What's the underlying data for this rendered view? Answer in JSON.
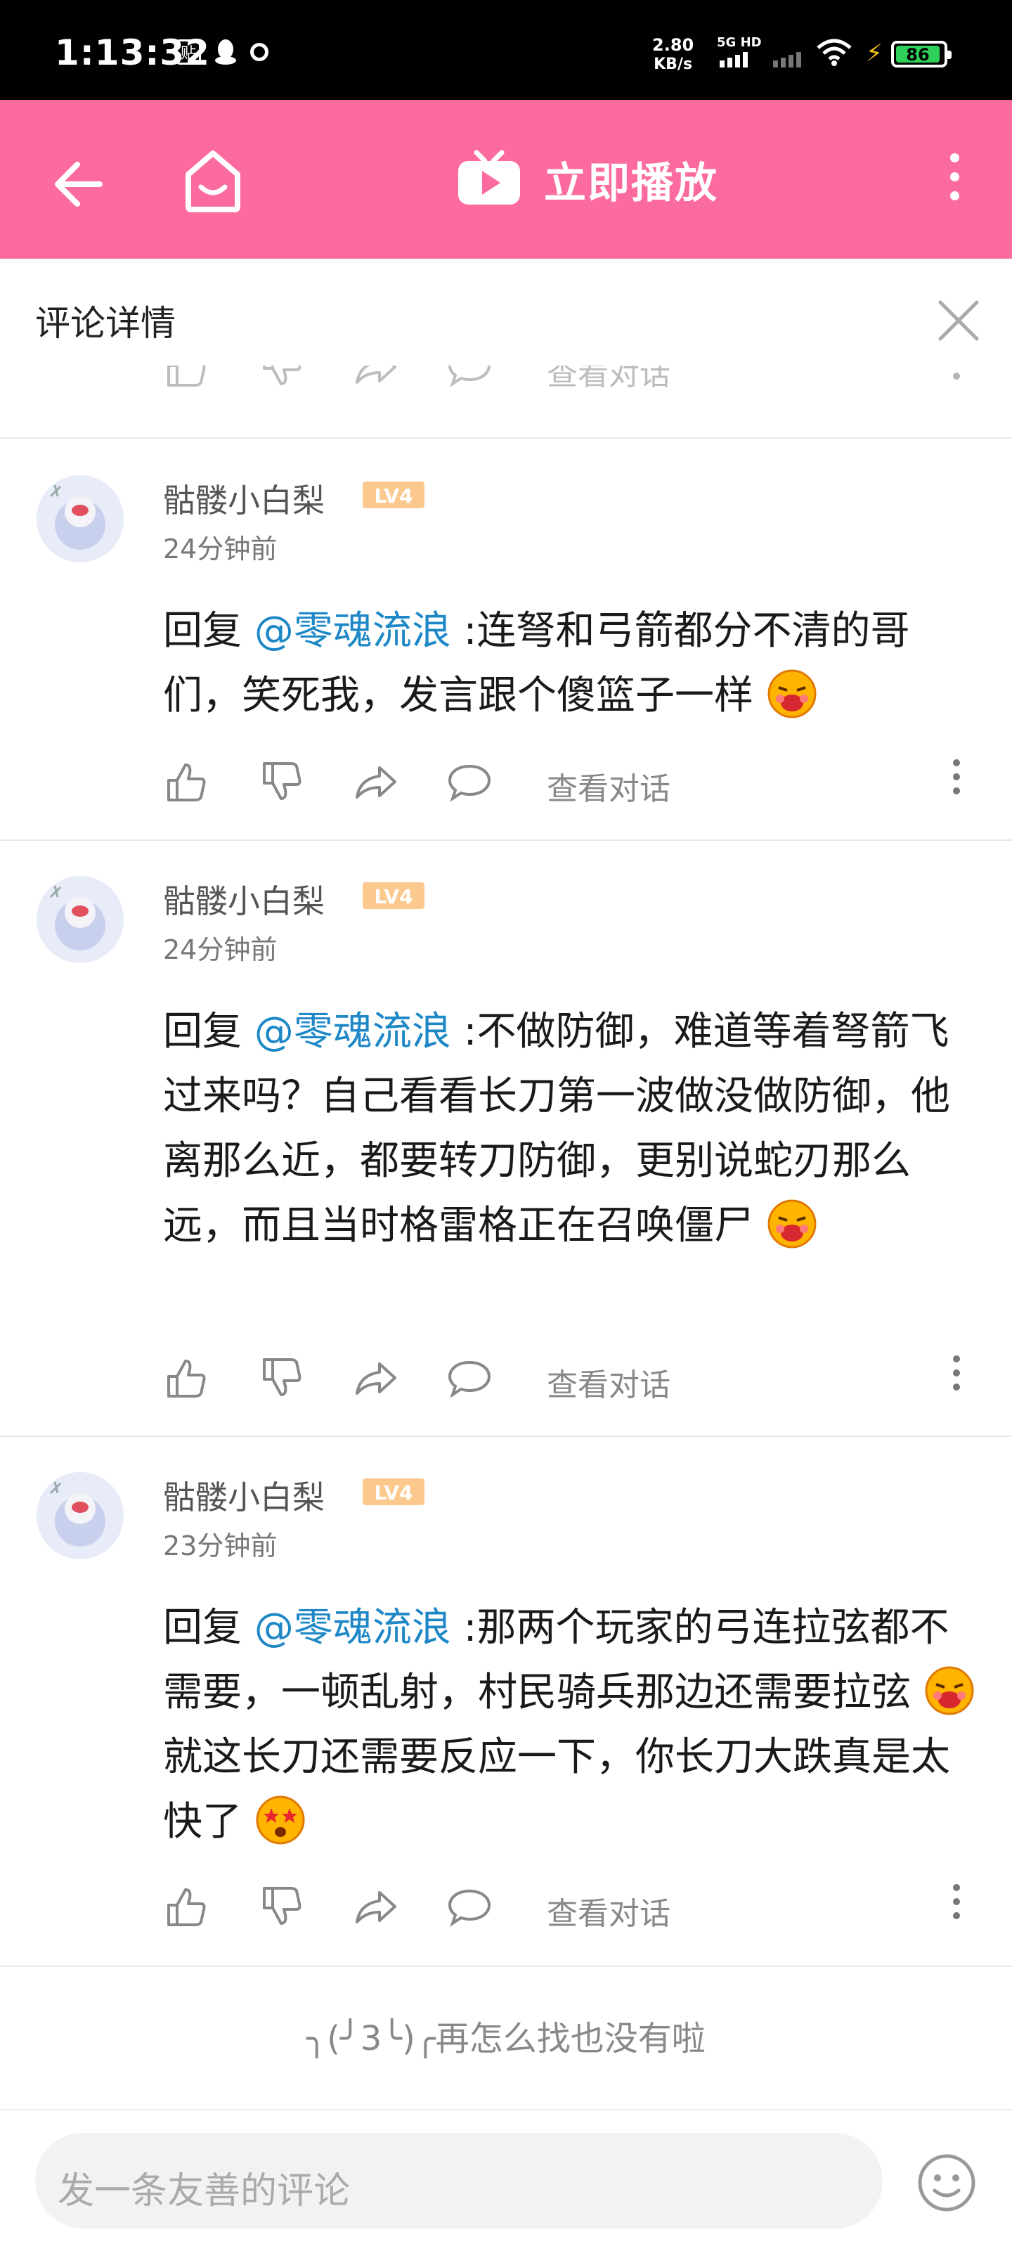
{
  "status_bar": {
    "time": "1:13:32",
    "net_speed_top": "2.80",
    "net_speed_unit": "KB/s",
    "signal_label": "5G HD",
    "battery": "86",
    "notif_icon_1": "贴"
  },
  "top_bar": {
    "title": "立即播放",
    "back_icon": "back-arrow-icon",
    "home_icon": "home-icon",
    "tv_icon": "tv-play-icon",
    "more_icon": "more-vertical-icon",
    "bg_color": "#fb6ba0"
  },
  "panel": {
    "title": "评论详情",
    "close_icon": "close-icon"
  },
  "comments": [
    {
      "user": "骷髅小白梨",
      "level": "LV4",
      "time": "24分钟前",
      "reply_prefix": "回复 ",
      "mention": "@零魂流浪",
      "text": " :连弩和弓箭都分不清的哥们，笑死我，发言跟个傻篮子一样",
      "action_label": "查看对话"
    },
    {
      "user": "骷髅小白梨",
      "level": "LV4",
      "time": "24分钟前",
      "reply_prefix": "回复 ",
      "mention": "@零魂流浪",
      "text": " :不做防御，难道等着弩箭飞过来吗？自己看看长刀第一波做没做防御，他离那么近，都要转刀防御，更别说蛇刃那么远，而且当时格雷格正在召唤僵尸",
      "action_label": "查看对话"
    },
    {
      "user": "骷髅小白梨",
      "level": "LV4",
      "time": "23分钟前",
      "reply_prefix": "回复 ",
      "mention": "@零魂流浪",
      "text_1": " :那两个玩家的弓连拉弦都不需要，一顿乱射，村民骑兵那边还需要拉弦",
      "text_2": "就这长刀还需要反应一下，你长刀大跌真是太快了",
      "action_label": "查看对话"
    }
  ],
  "partial_row": {
    "action_label": "查看对话"
  },
  "end_message": "╮(╯3╰)╭再怎么找也没有啦",
  "bottom": {
    "input_placeholder": "发一条友善的评论",
    "emoji_icon": "emoji-face-icon"
  }
}
